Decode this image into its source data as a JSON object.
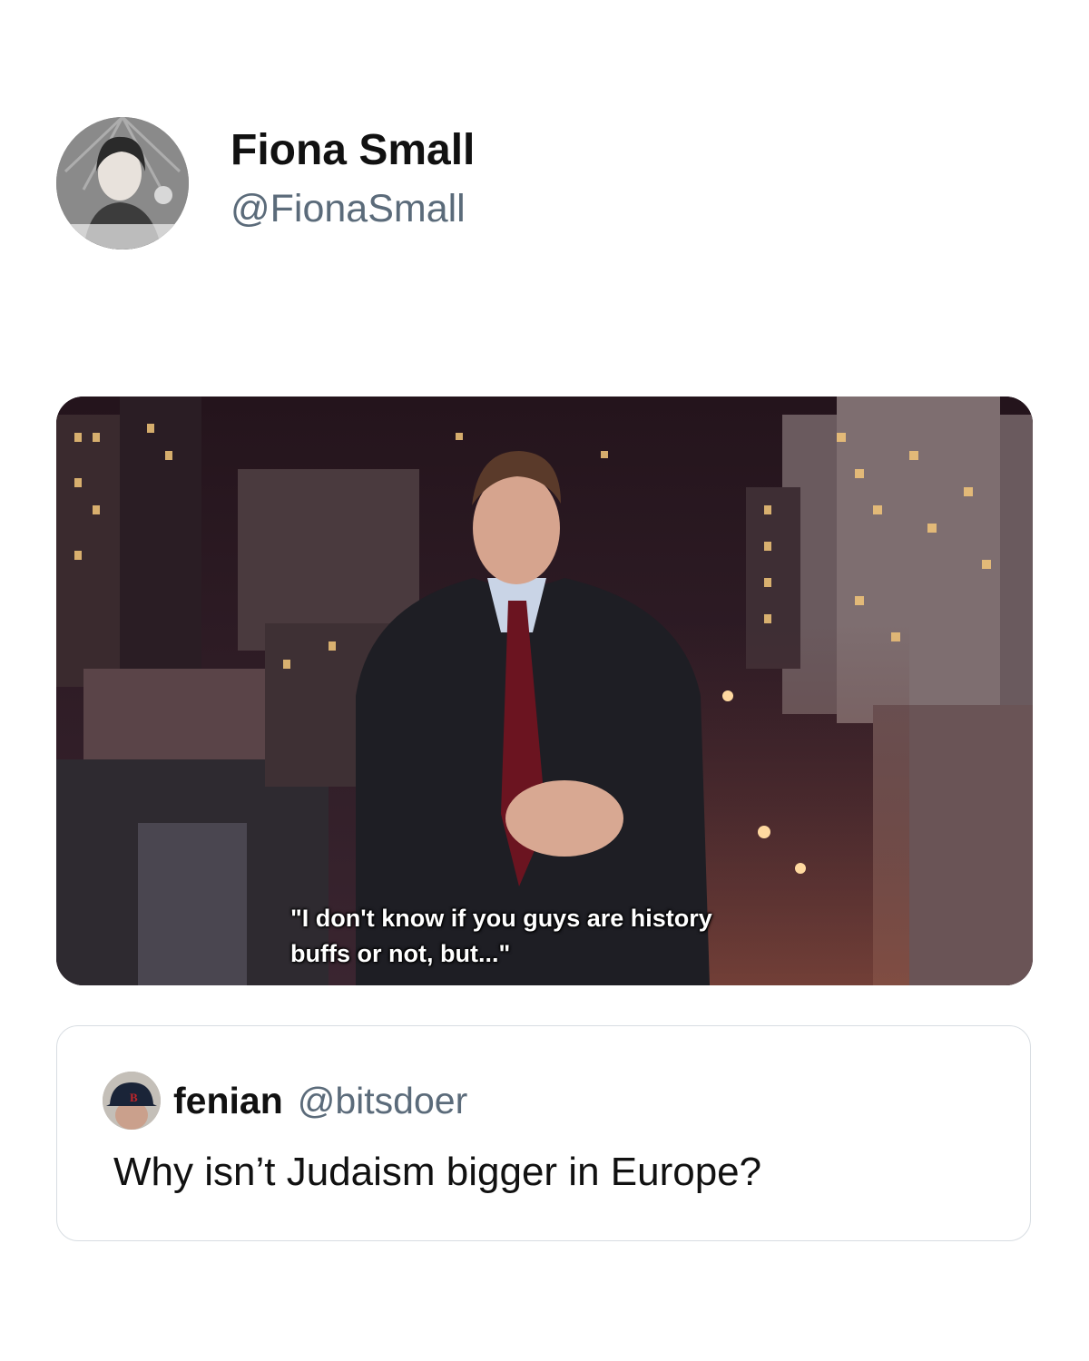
{
  "tweet": {
    "author": {
      "display_name": "Fiona Small",
      "handle": "@FionaSmall"
    },
    "media": {
      "caption_line1": "\"I don't know if you guys are history",
      "caption_line2": "buffs or not, but...\""
    }
  },
  "quoted_tweet": {
    "author": {
      "display_name": "fenian",
      "handle": "@bitsdoer"
    },
    "text": "Why isn’t Judaism bigger in Europe?"
  },
  "colors": {
    "name": "#111111",
    "handle": "#5b6b7a",
    "border": "#d8dde2"
  }
}
